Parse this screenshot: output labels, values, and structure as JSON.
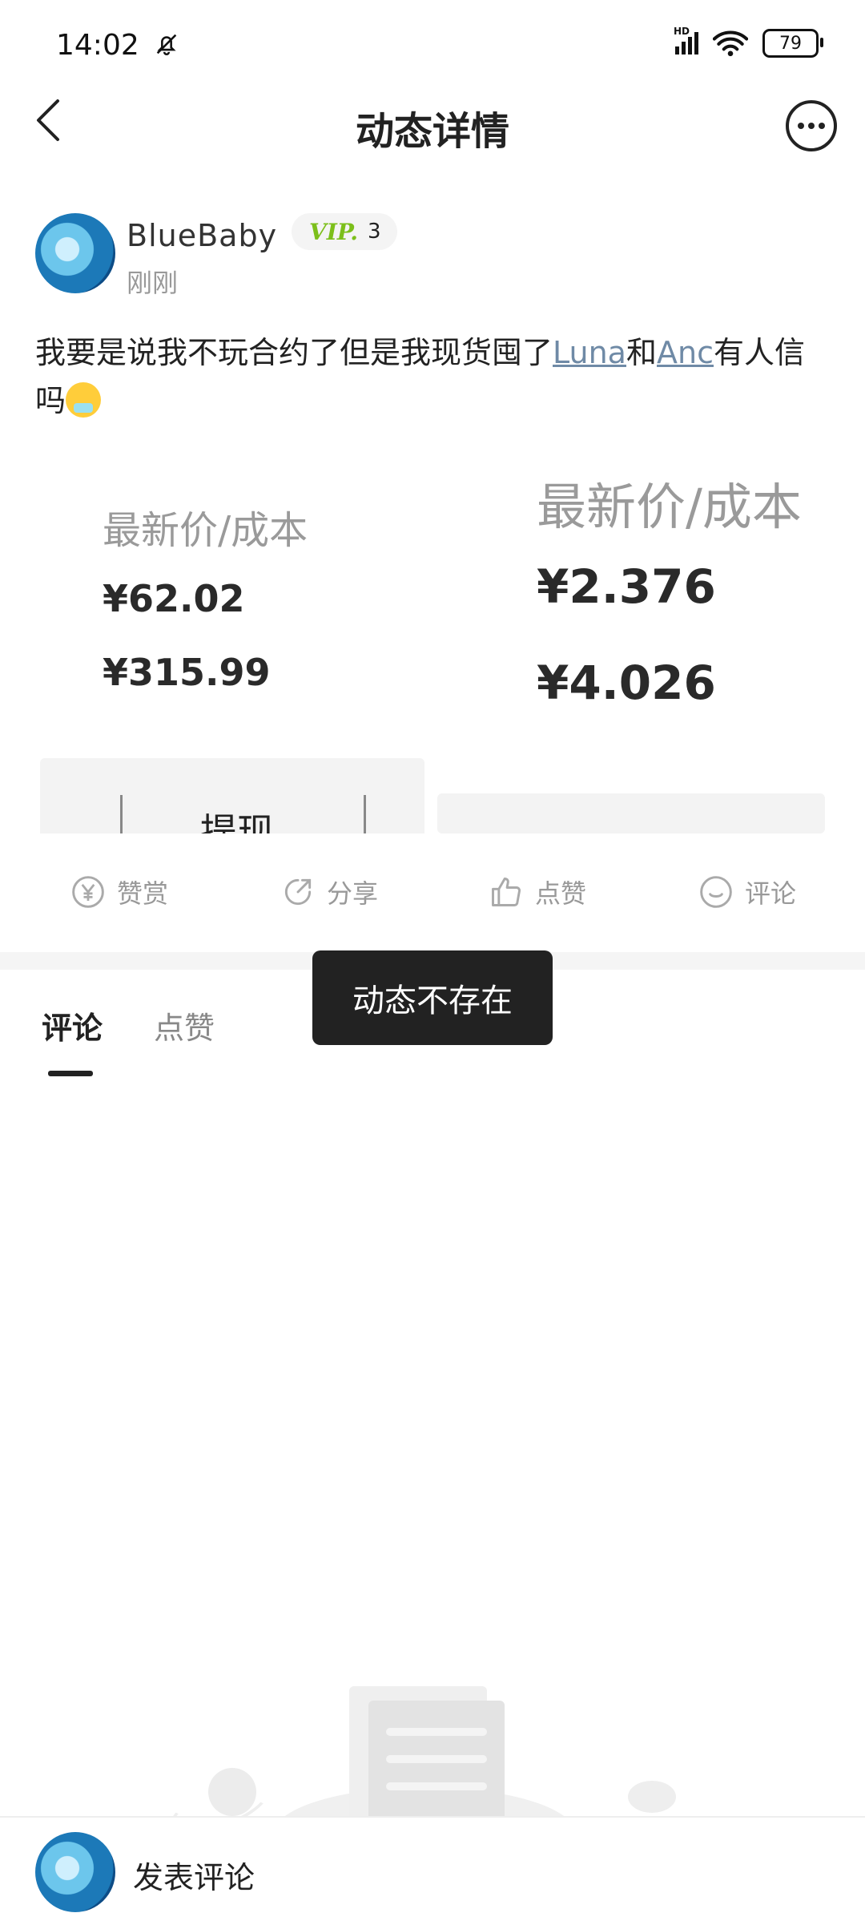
{
  "status_bar": {
    "time": "14:02",
    "battery": "79",
    "network_label": "HD"
  },
  "header": {
    "title": "动态详情"
  },
  "author": {
    "name": "BlueBaby",
    "time": "刚刚",
    "vip_mark": "VIP.",
    "vip_level": "3"
  },
  "post": {
    "text_before": "我要是说我不玩合约了但是我现货囤了",
    "link1": "Luna",
    "text_mid": "和",
    "link2": "Anc",
    "text_after": "有人信吗"
  },
  "images": {
    "left": {
      "label": "最新价/成本",
      "price1": "¥62.02",
      "price2": "¥315.99",
      "button": "提现"
    },
    "right": {
      "label": "最新价/成本",
      "price1": "¥2.376",
      "price2": "¥4.026"
    }
  },
  "actions": {
    "reward": "赞赏",
    "share": "分享",
    "like": "点赞",
    "comment": "评论"
  },
  "tabs": {
    "comments": "评论",
    "likes": "点赞"
  },
  "toast": "动态不存在",
  "bottom_bar": {
    "comment_prompt": "发表评论"
  },
  "colors": {
    "link": "#6f8aa6",
    "vip_green": "#7cbf1a",
    "toast_bg": "#222222"
  }
}
